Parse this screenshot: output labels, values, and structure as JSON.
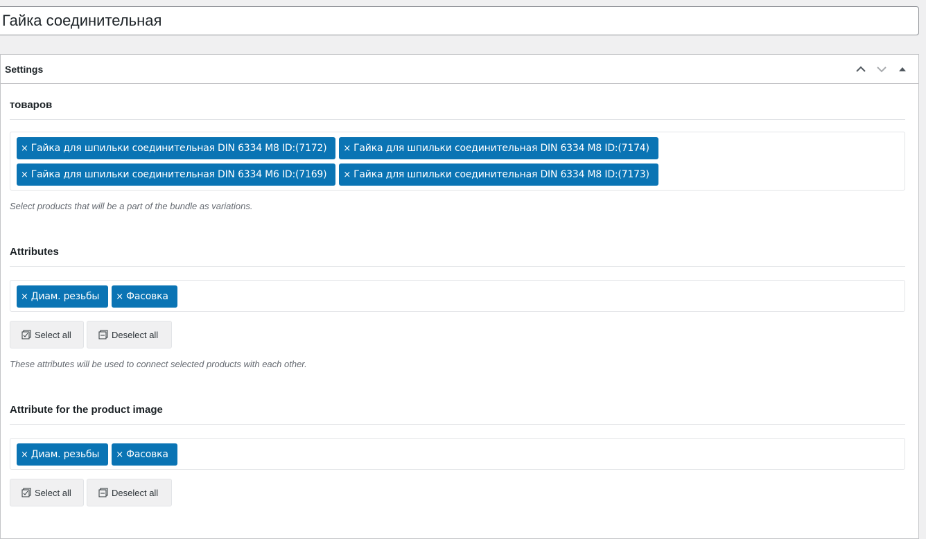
{
  "title_input": {
    "value": "Гайка соединительная"
  },
  "postbox": {
    "title": "Settings",
    "icons": {
      "up": "chevron-up-icon",
      "down": "chevron-down-icon",
      "toggle": "triangle-up-icon"
    }
  },
  "products_section": {
    "heading": "товаров",
    "tags": [
      "Гайка для шпильки соединительная DIN 6334 M8 ID:(7172)",
      "Гайка для шпильки соединительная DIN 6334 M8 ID:(7174)",
      "Гайка для шпильки соединительная DIN 6334 M6 ID:(7169)",
      "Гайка для шпильки соединительная DIN 6334 M8 ID:(7173)"
    ],
    "remove_symbol": "×",
    "description": "Select products that will be a part of the bundle as variations."
  },
  "attributes_section": {
    "heading": "Attributes",
    "tags": [
      "Диам. резьбы",
      "Фасовка"
    ],
    "select_all": "Select all",
    "deselect_all": "Deselect all",
    "description": "These attributes will be used to connect selected products with each other."
  },
  "image_attr_section": {
    "heading": "Attribute for the product image",
    "tags": [
      "Диам. резьбы",
      "Фасовка"
    ],
    "select_all": "Select all",
    "deselect_all": "Deselect all"
  },
  "colors": {
    "tag_bg": "#0a74b4",
    "tag_text": "#ffffff",
    "desc_text": "#646970"
  }
}
